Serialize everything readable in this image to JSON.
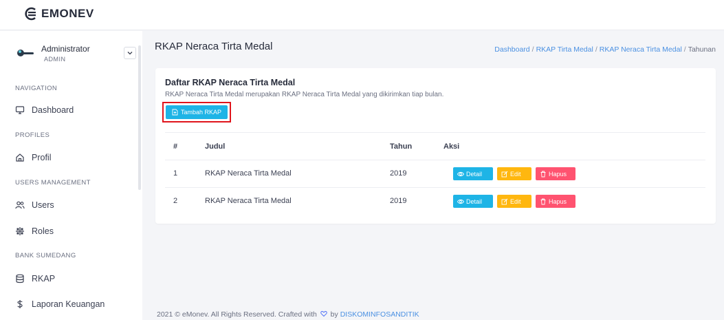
{
  "brand": {
    "name": "EMONEV"
  },
  "user": {
    "name": "Administrator",
    "role": "ADMIN"
  },
  "nav": {
    "captions": {
      "navigation": "NAVIGATION",
      "profiles": "PROFILES",
      "users_management": "USERS MANAGEMENT",
      "bank": "BANK SUMEDANG"
    },
    "items": {
      "dashboard": "Dashboard",
      "profil": "Profil",
      "users": "Users",
      "roles": "Roles",
      "rkap": "RKAP",
      "laporan": "Laporan Keuangan"
    }
  },
  "page": {
    "title": "RKAP Neraca Tirta Medal",
    "breadcrumb": [
      "Dashboard",
      "RKAP Tirta Medal",
      "RKAP Neraca Tirta Medal",
      "Tahunan"
    ]
  },
  "card": {
    "title": "Daftar RKAP Neraca Tirta Medal",
    "description": "RKAP Neraca Tirta Medal merupakan RKAP Neraca Tirta Medal yang dikirimkan tiap bulan.",
    "add_label": "Tambah RKAP"
  },
  "table": {
    "headers": {
      "no": "#",
      "judul": "Judul",
      "tahun": "Tahun",
      "aksi": "Aksi"
    },
    "rows": [
      {
        "no": "1",
        "judul": "RKAP Neraca Tirta Medal",
        "tahun": "2019"
      },
      {
        "no": "2",
        "judul": "RKAP Neraca Tirta Medal",
        "tahun": "2019"
      }
    ],
    "actions": {
      "detail": "Detail",
      "edit": "Edit",
      "hapus": "Hapus"
    }
  },
  "footer": {
    "text": "2021 © eMonev. All Rights Reserved. Crafted with",
    "by": "by",
    "link": "DISKOMINFOSANDITIK"
  },
  "colors": {
    "primary": "#1eb4e6",
    "warning": "#ffb70f",
    "danger": "#ff5370",
    "link": "#4a90e2",
    "highlight": "#e0141b"
  },
  "icons": {
    "brand": "emonev-logo-icon",
    "dashboard": "monitor-icon",
    "profil": "home-icon",
    "users": "users-icon",
    "roles": "roles-icon",
    "rkap": "database-icon",
    "laporan": "dollar-icon"
  }
}
